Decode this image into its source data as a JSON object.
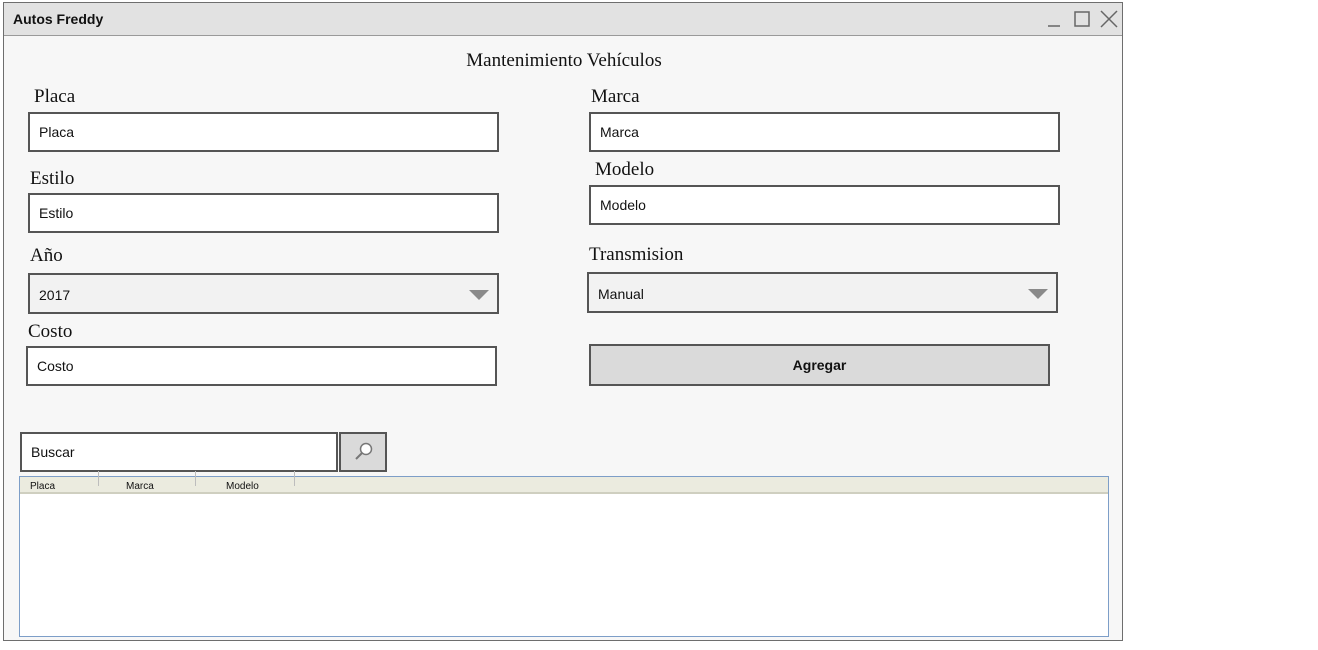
{
  "window": {
    "title": "Autos Freddy"
  },
  "form": {
    "heading": "Mantenimiento Vehículos",
    "placa": {
      "label": "Placa",
      "value": "Placa"
    },
    "marca": {
      "label": "Marca",
      "value": "Marca"
    },
    "estilo": {
      "label": "Estilo",
      "value": "Estilo"
    },
    "modelo": {
      "label": "Modelo",
      "value": "Modelo"
    },
    "anio": {
      "label": "Año",
      "selected": "2017"
    },
    "transmision": {
      "label": "Transmision",
      "selected": "Manual"
    },
    "costo": {
      "label": "Costo",
      "value": "Costo"
    },
    "agregar_label": "Agregar"
  },
  "search": {
    "value": "Buscar",
    "icon": "search-icon"
  },
  "table": {
    "columns": [
      "Placa",
      "Marca",
      "Modelo"
    ],
    "rows": []
  },
  "colors": {
    "titlebar": "#e2e2e2",
    "window_bg": "#f7f7f7",
    "button_bg": "#dadada",
    "grid_header": "#ebebdf"
  }
}
